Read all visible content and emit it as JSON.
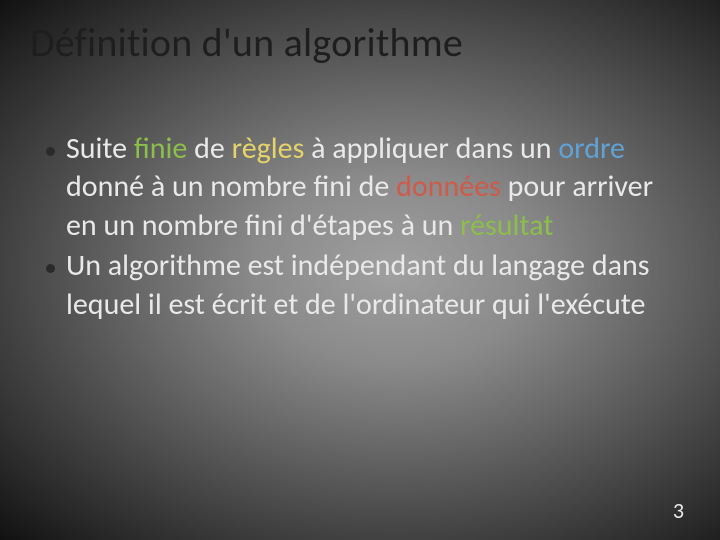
{
  "title": "Définition d'un algorithme",
  "bullets": [
    {
      "pre": "Suite",
      "kw1": "finie",
      "mid1": "de",
      "kw2": "règles",
      "mid2": "à appliquer dans un",
      "kw3": "ordre",
      "mid3": "donné à un nombre fini de",
      "kw4": "données",
      "mid4": "pour arriver en un nombre fini d'étapes à un",
      "kw5": "résultat"
    },
    {
      "text": "Un algorithme est indépendant du langage dans lequel il est écrit et de l'ordinateur qui l'exécute"
    }
  ],
  "page_number": "3"
}
